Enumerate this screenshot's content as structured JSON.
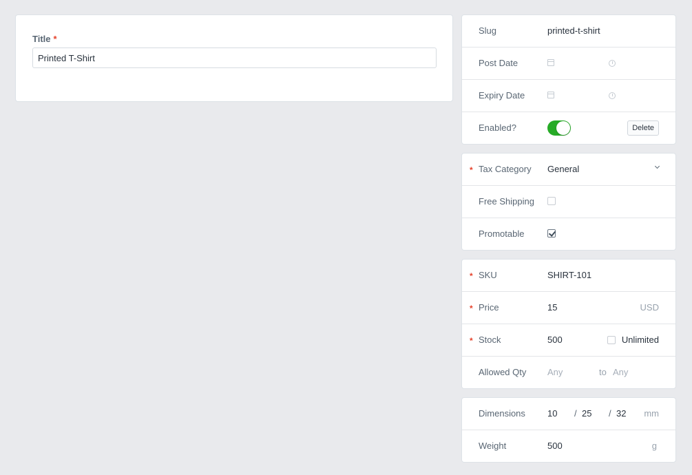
{
  "main": {
    "title_label": "Title",
    "required_mark": "*",
    "title_value": "Printed T-Shirt"
  },
  "meta": {
    "slug_label": "Slug",
    "slug_value": "printed-t-shirt",
    "post_date_label": "Post Date",
    "expiry_date_label": "Expiry Date",
    "enabled_label": "Enabled?",
    "enabled": true,
    "delete_label": "Delete"
  },
  "tax": {
    "tax_category_label": "Tax Category",
    "tax_category_value": "General",
    "free_shipping_label": "Free Shipping",
    "free_shipping_checked": false,
    "promotable_label": "Promotable",
    "promotable_checked": true
  },
  "inventory": {
    "sku_label": "SKU",
    "sku_value": "SHIRT-101",
    "price_label": "Price",
    "price_value": "15",
    "price_currency": "USD",
    "stock_label": "Stock",
    "stock_value": "500",
    "unlimited_label": "Unlimited",
    "unlimited_checked": false,
    "allowed_qty_label": "Allowed Qty",
    "allowed_qty_min_placeholder": "Any",
    "allowed_qty_to": "to",
    "allowed_qty_max_placeholder": "Any"
  },
  "dimensions": {
    "dimensions_label": "Dimensions",
    "length": "10",
    "width": "25",
    "height": "32",
    "separator": "/",
    "dimension_unit": "mm",
    "weight_label": "Weight",
    "weight_value": "500",
    "weight_unit": "g"
  },
  "colors": {
    "background": "#e9eaed",
    "required": "#e5422b",
    "toggle_on": "#27ab27"
  },
  "icons": [
    "calendar-icon",
    "clock-icon",
    "chevron-down-icon",
    "checkbox-icon"
  ]
}
